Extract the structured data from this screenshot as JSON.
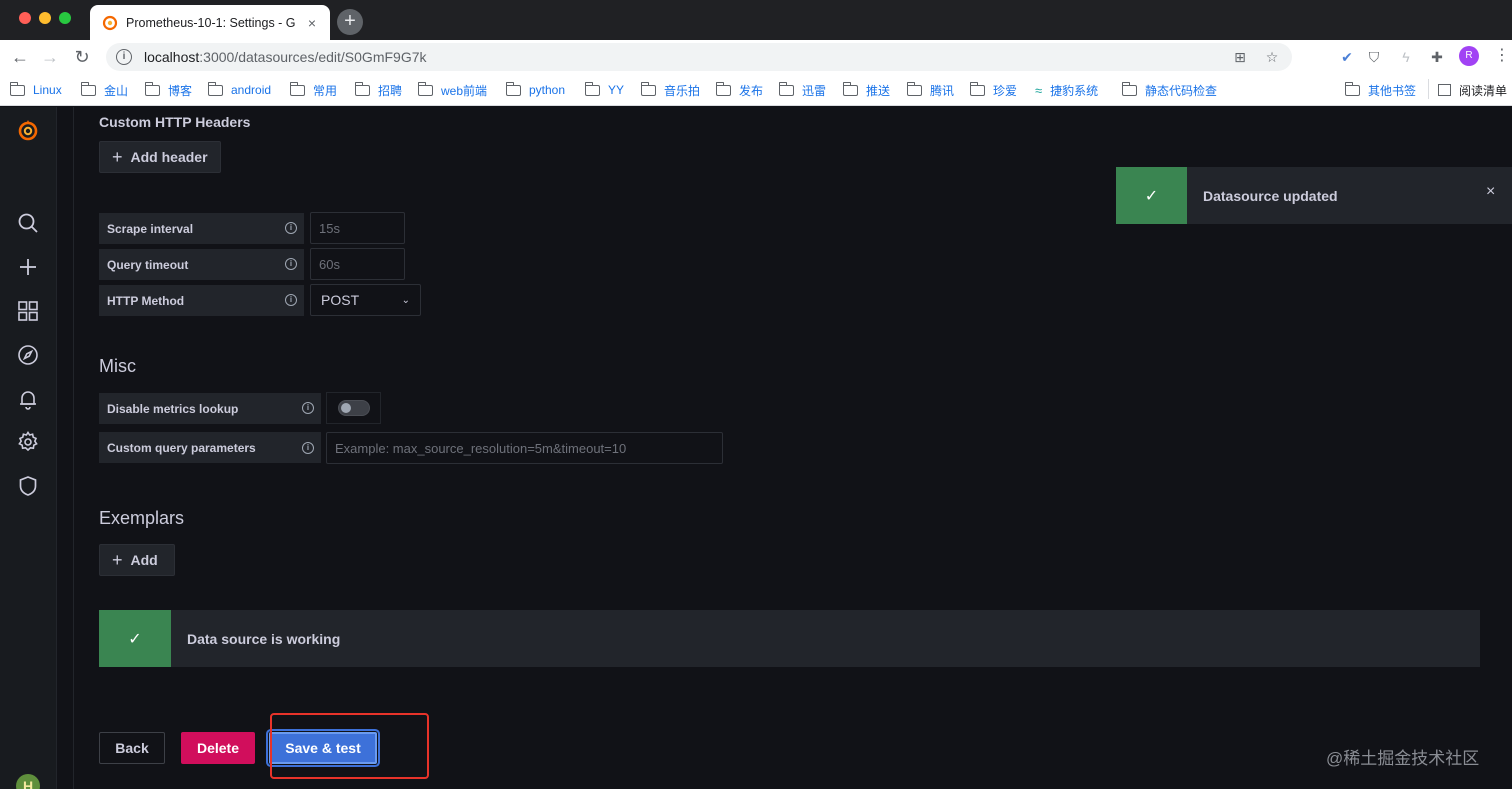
{
  "browser": {
    "tab_title": "Prometheus-10-1: Settings - G",
    "tab_close": "×",
    "new_tab": "+",
    "url_host": "localhost",
    "url_path": ":3000/datasources/edit/S0GmF9G7k",
    "profile_initial": "R",
    "icons": [
      "back-icon",
      "forward-icon",
      "reload-icon",
      "info-icon",
      "translate-icon",
      "star-icon",
      "extension-icon",
      "puzzle-icon",
      "menu-icon"
    ]
  },
  "bookmarks": [
    {
      "label": "Linux"
    },
    {
      "label": "金山"
    },
    {
      "label": "博客"
    },
    {
      "label": "android"
    },
    {
      "label": "常用"
    },
    {
      "label": "招聘"
    },
    {
      "label": "web前端"
    },
    {
      "label": "python"
    },
    {
      "label": "YY"
    },
    {
      "label": "音乐拍"
    },
    {
      "label": "发布"
    },
    {
      "label": "迅雷"
    },
    {
      "label": "推送"
    },
    {
      "label": "腾讯"
    },
    {
      "label": "珍爱"
    },
    {
      "label": "捷豹系统"
    },
    {
      "label": "静态代码检查"
    },
    {
      "label": "其他书签"
    },
    {
      "label": "阅读清单"
    }
  ],
  "sidemenu": {
    "items": [
      "grafana-logo",
      "search-icon",
      "plus-icon",
      "dashboards-icon",
      "explore-icon",
      "alerting-icon",
      "settings-icon",
      "shield-icon"
    ],
    "avatar_initial": "H"
  },
  "http": {
    "custom_headers_title": "Custom HTTP Headers",
    "add_header_label": "Add header",
    "plus": "+"
  },
  "fields": {
    "scrape_interval": {
      "label": "Scrape interval",
      "placeholder": "15s"
    },
    "query_timeout": {
      "label": "Query timeout",
      "placeholder": "60s"
    },
    "http_method": {
      "label": "HTTP Method",
      "value": "POST"
    }
  },
  "misc": {
    "title": "Misc",
    "disable_metrics_label": "Disable metrics lookup",
    "custom_query_label": "Custom query parameters",
    "custom_query_placeholder": "Example: max_source_resolution=5m&timeout=10"
  },
  "exemplars": {
    "title": "Exemplars",
    "add_label": "Add"
  },
  "status": {
    "working_text": "Data source is working",
    "toast_text": "Datasource updated",
    "check": "✓",
    "close": "×",
    "success_color": "#3a8551"
  },
  "footer": {
    "back_label": "Back",
    "delete_label": "Delete",
    "save_label": "Save & test"
  },
  "watermark": "@稀土掘金技术社区",
  "colors": {
    "background": "#111217",
    "primary": "#3d71d9",
    "destructive": "#d10e5c",
    "annotation": "#e8332a"
  }
}
